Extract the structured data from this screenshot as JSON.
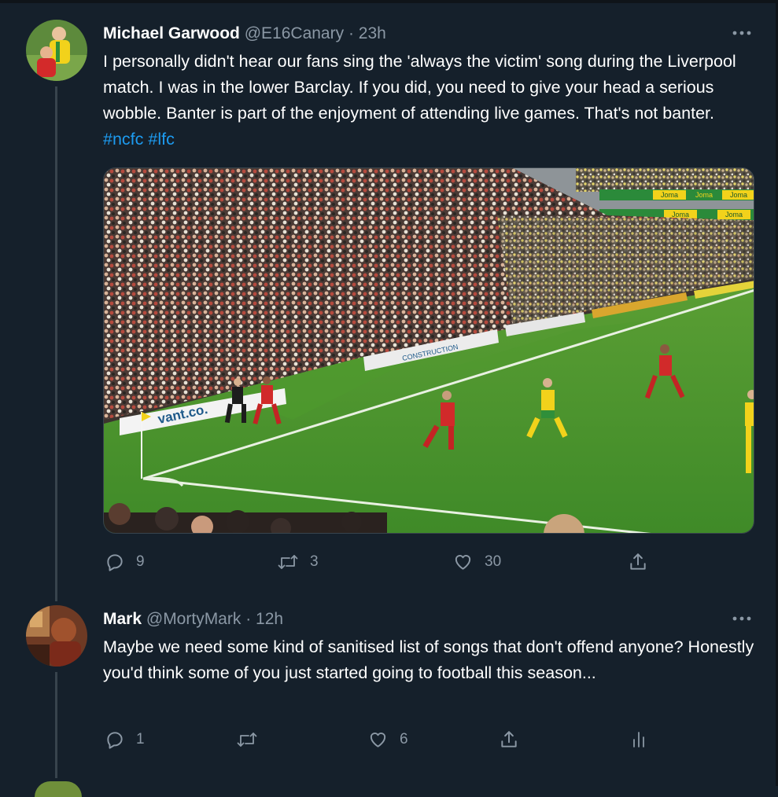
{
  "tweets": [
    {
      "name": "Michael Garwood",
      "handle": "@E16Canary",
      "separator": "·",
      "time": "23h",
      "text": "I personally didn't hear our fans sing the 'always the victim' song during the Liverpool match. I was in the lower Barclay. If you did, you need to give your head a serious wobble. Banter is part of the enjoyment of attending live games. That's not banter. ",
      "hashtags": [
        "#ncfc",
        "#lfc"
      ],
      "ad_board_text": [
        "Joma",
        "Joma",
        "Joma",
        "Joma",
        "Joma",
        "vant.co.",
        "CONSTRUCTION"
      ],
      "actions": {
        "replies": "9",
        "retweets": "3",
        "likes": "30"
      }
    },
    {
      "name": "Mark",
      "handle": "@MortyMark",
      "separator": "·",
      "time": "12h",
      "text": "Maybe we need some kind of sanitised list of songs that don't offend anyone? Honestly you'd think some of you just started going to football this season...",
      "actions": {
        "replies": "1",
        "retweets": "",
        "likes": "6"
      }
    }
  ],
  "colors": {
    "background": "#15202b",
    "text": "#ffffff",
    "secondary": "#8b98a5",
    "link": "#1d9bf0",
    "thread_line": "#38444d"
  },
  "icons": [
    "more-icon",
    "reply-icon",
    "retweet-icon",
    "like-icon",
    "share-icon",
    "analytics-icon"
  ]
}
